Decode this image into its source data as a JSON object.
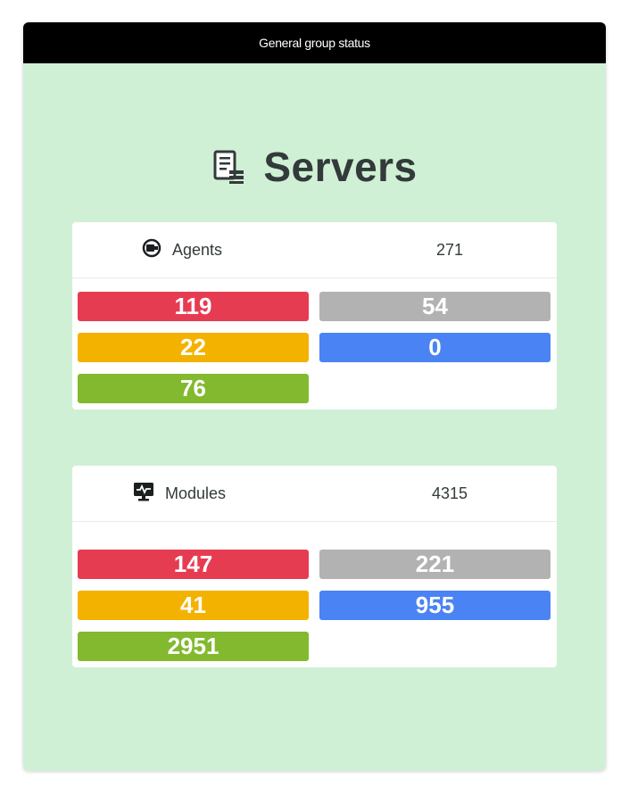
{
  "header": {
    "title": "General group status"
  },
  "group": {
    "title": "Servers",
    "icon": "server-icon"
  },
  "colors": {
    "critical": "#e63c52",
    "unknown": "#b2b2b2",
    "warning": "#f3b200",
    "not_init": "#4a83f3",
    "normal": "#82b92e"
  },
  "agents": {
    "label": "Agents",
    "icon": "agent-plug-icon",
    "total": "271",
    "critical": "119",
    "unknown": "54",
    "warning": "22",
    "not_init": "0",
    "normal": "76"
  },
  "modules": {
    "label": "Modules",
    "icon": "module-monitor-icon",
    "total": "4315",
    "critical": "147",
    "unknown": "221",
    "warning": "41",
    "not_init": "955",
    "normal": "2951"
  }
}
